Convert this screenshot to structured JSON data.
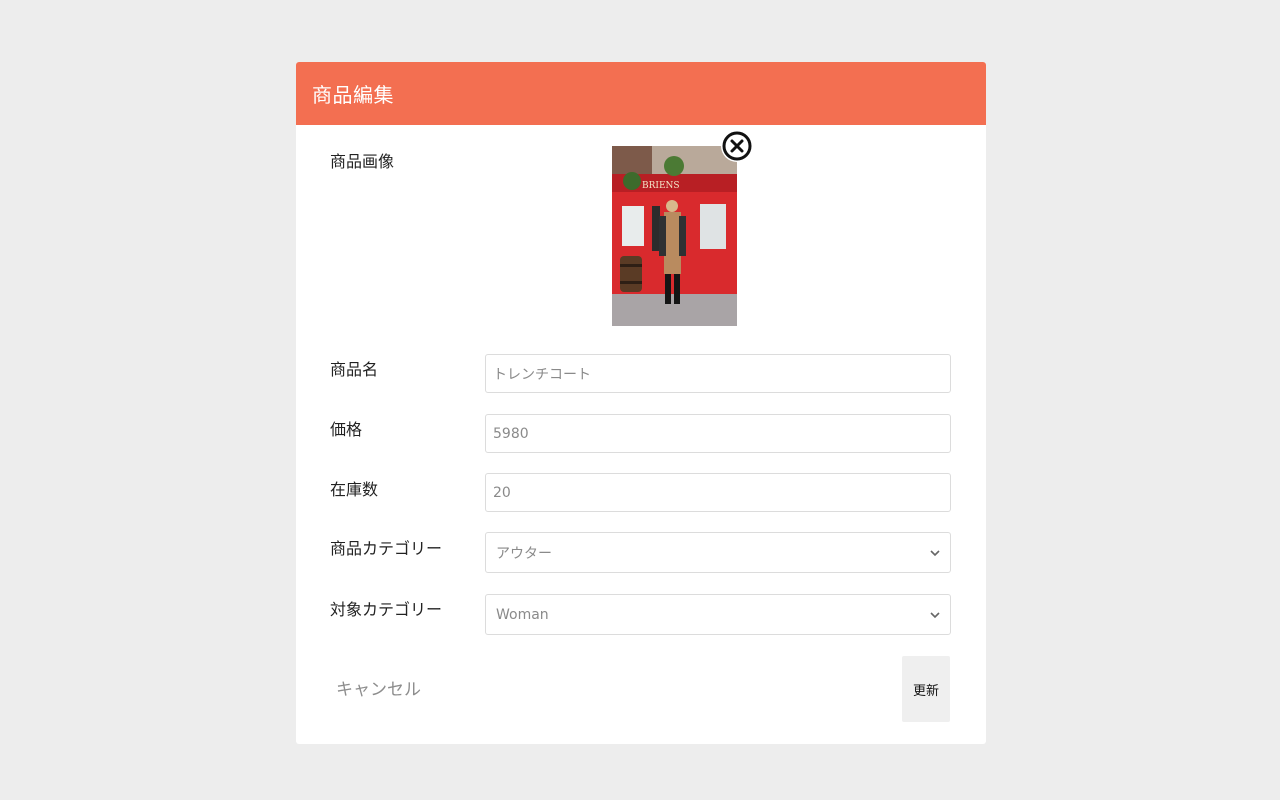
{
  "header": {
    "title": "商品編集"
  },
  "form": {
    "image": {
      "label": "商品画像",
      "remove_icon": "close-circle-icon"
    },
    "name": {
      "label": "商品名",
      "value": "トレンチコート"
    },
    "price": {
      "label": "価格",
      "value": "5980"
    },
    "stock": {
      "label": "在庫数",
      "value": "20"
    },
    "product_category": {
      "label": "商品カテゴリー",
      "selected": "アウター"
    },
    "target_category": {
      "label": "対象カテゴリー",
      "selected": "Woman"
    }
  },
  "footer": {
    "cancel_label": "キャンセル",
    "update_label": "更新"
  },
  "colors": {
    "header_bg": "#f36f51",
    "page_bg": "#ededed"
  }
}
